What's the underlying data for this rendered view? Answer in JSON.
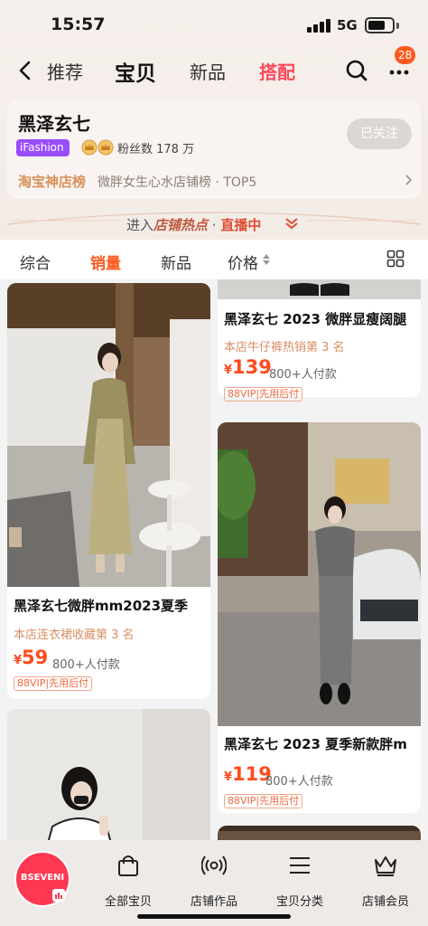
{
  "status_bar": {
    "time": "15:57",
    "network": "5G",
    "battery_level": 0.72
  },
  "nav": {
    "tabs": [
      "推荐",
      "宝贝",
      "新品",
      "搭配"
    ],
    "active_tab": "宝贝",
    "highlight_tab": "搭配",
    "badge_count": "28"
  },
  "store": {
    "name": "黑泽玄七",
    "brand_tag": "iFashion",
    "fans": "粉丝数 178 万",
    "follow_label": "已关注",
    "rank_title": "淘宝神店榜",
    "rank_desc": "微胖女生心水店铺榜 · TOP5"
  },
  "hotspot": {
    "prefix": "进入",
    "em": "店铺热点",
    "sep": " · ",
    "live": "直播中"
  },
  "sortbar": {
    "items": [
      "综合",
      "销量",
      "新品",
      "价格"
    ],
    "active": "销量"
  },
  "products": [
    {
      "title": "黑泽玄七微胖mm2023夏季",
      "rank": "本店连衣裙收藏第 3 名",
      "price": "59",
      "paid": "800+人付款",
      "vip": "88VIP|先用后付"
    },
    {
      "title": "黑泽玄七 2023 微胖显瘦阔腿",
      "rank": "本店牛仔裤热销第 3 名",
      "price": "139",
      "paid": "800+人付款",
      "vip": "88VIP|先用后付"
    },
    {
      "title": "黑泽玄七 2023 夏季新款胖m",
      "rank": "",
      "price": "119",
      "paid": "800+人付款",
      "vip": "88VIP|先用后付"
    }
  ],
  "currency": "¥",
  "tabbar": {
    "logo_text": "BSEVENI",
    "items": [
      "全部宝贝",
      "店铺作品",
      "宝贝分类",
      "店铺会员"
    ]
  },
  "colors": {
    "accent": "#ff5a1f",
    "highlight": "#ff4a5a",
    "logo": "#ff3852"
  }
}
